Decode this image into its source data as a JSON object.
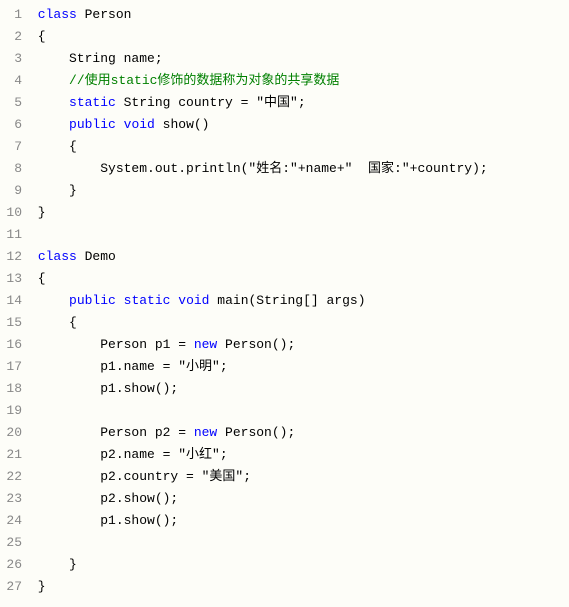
{
  "code": {
    "lines": [
      {
        "num": "1",
        "tokens": [
          {
            "t": "kw",
            "v": " class"
          },
          {
            "t": "plain",
            "v": " Person"
          }
        ]
      },
      {
        "num": "2",
        "tokens": [
          {
            "t": "plain",
            "v": " {"
          }
        ]
      },
      {
        "num": "3",
        "tokens": [
          {
            "t": "plain",
            "v": "     String name;"
          }
        ]
      },
      {
        "num": "4",
        "tokens": [
          {
            "t": "plain",
            "v": "     "
          },
          {
            "t": "comment",
            "v": "//使用static修饰的数据称为对象的共享数据"
          }
        ]
      },
      {
        "num": "5",
        "tokens": [
          {
            "t": "plain",
            "v": "     "
          },
          {
            "t": "kw",
            "v": "static"
          },
          {
            "t": "plain",
            "v": " String country = \"中国\";"
          }
        ]
      },
      {
        "num": "6",
        "tokens": [
          {
            "t": "plain",
            "v": "     "
          },
          {
            "t": "kw",
            "v": "public"
          },
          {
            "t": "plain",
            "v": " "
          },
          {
            "t": "kw",
            "v": "void"
          },
          {
            "t": "plain",
            "v": " show()"
          }
        ]
      },
      {
        "num": "7",
        "tokens": [
          {
            "t": "plain",
            "v": "     {"
          }
        ]
      },
      {
        "num": "8",
        "tokens": [
          {
            "t": "plain",
            "v": "         System.out.println(\"姓名:\"+name+\"  国家:\"+country);"
          }
        ]
      },
      {
        "num": "9",
        "tokens": [
          {
            "t": "plain",
            "v": "     }"
          }
        ]
      },
      {
        "num": "10",
        "tokens": [
          {
            "t": "plain",
            "v": " }"
          }
        ]
      },
      {
        "num": "11",
        "tokens": [
          {
            "t": "plain",
            "v": ""
          }
        ]
      },
      {
        "num": "12",
        "tokens": [
          {
            "t": "plain",
            "v": " "
          },
          {
            "t": "kw",
            "v": "class"
          },
          {
            "t": "plain",
            "v": " Demo"
          }
        ]
      },
      {
        "num": "13",
        "tokens": [
          {
            "t": "plain",
            "v": " {"
          }
        ]
      },
      {
        "num": "14",
        "tokens": [
          {
            "t": "plain",
            "v": "     "
          },
          {
            "t": "kw",
            "v": "public"
          },
          {
            "t": "plain",
            "v": " "
          },
          {
            "t": "kw",
            "v": "static"
          },
          {
            "t": "plain",
            "v": " "
          },
          {
            "t": "kw",
            "v": "void"
          },
          {
            "t": "plain",
            "v": " main(String[] args)"
          }
        ]
      },
      {
        "num": "15",
        "tokens": [
          {
            "t": "plain",
            "v": "     {"
          }
        ]
      },
      {
        "num": "16",
        "tokens": [
          {
            "t": "plain",
            "v": "         Person p1 = "
          },
          {
            "t": "kw",
            "v": "new"
          },
          {
            "t": "plain",
            "v": " Person();"
          }
        ]
      },
      {
        "num": "17",
        "tokens": [
          {
            "t": "plain",
            "v": "         p1.name = \"小明\";"
          }
        ]
      },
      {
        "num": "18",
        "tokens": [
          {
            "t": "plain",
            "v": "         p1.show();"
          }
        ]
      },
      {
        "num": "19",
        "tokens": [
          {
            "t": "plain",
            "v": ""
          }
        ]
      },
      {
        "num": "20",
        "tokens": [
          {
            "t": "plain",
            "v": "         Person p2 = "
          },
          {
            "t": "kw",
            "v": "new"
          },
          {
            "t": "plain",
            "v": " Person();"
          }
        ]
      },
      {
        "num": "21",
        "tokens": [
          {
            "t": "plain",
            "v": "         p2.name = \"小红\";"
          }
        ]
      },
      {
        "num": "22",
        "tokens": [
          {
            "t": "plain",
            "v": "         p2.country = \"美国\";"
          }
        ]
      },
      {
        "num": "23",
        "tokens": [
          {
            "t": "plain",
            "v": "         p2.show();"
          }
        ]
      },
      {
        "num": "24",
        "tokens": [
          {
            "t": "plain",
            "v": "         p1.show();"
          }
        ]
      },
      {
        "num": "25",
        "tokens": [
          {
            "t": "plain",
            "v": ""
          }
        ]
      },
      {
        "num": "26",
        "tokens": [
          {
            "t": "plain",
            "v": "     }"
          }
        ]
      },
      {
        "num": "27",
        "tokens": [
          {
            "t": "plain",
            "v": " }"
          }
        ]
      }
    ]
  }
}
